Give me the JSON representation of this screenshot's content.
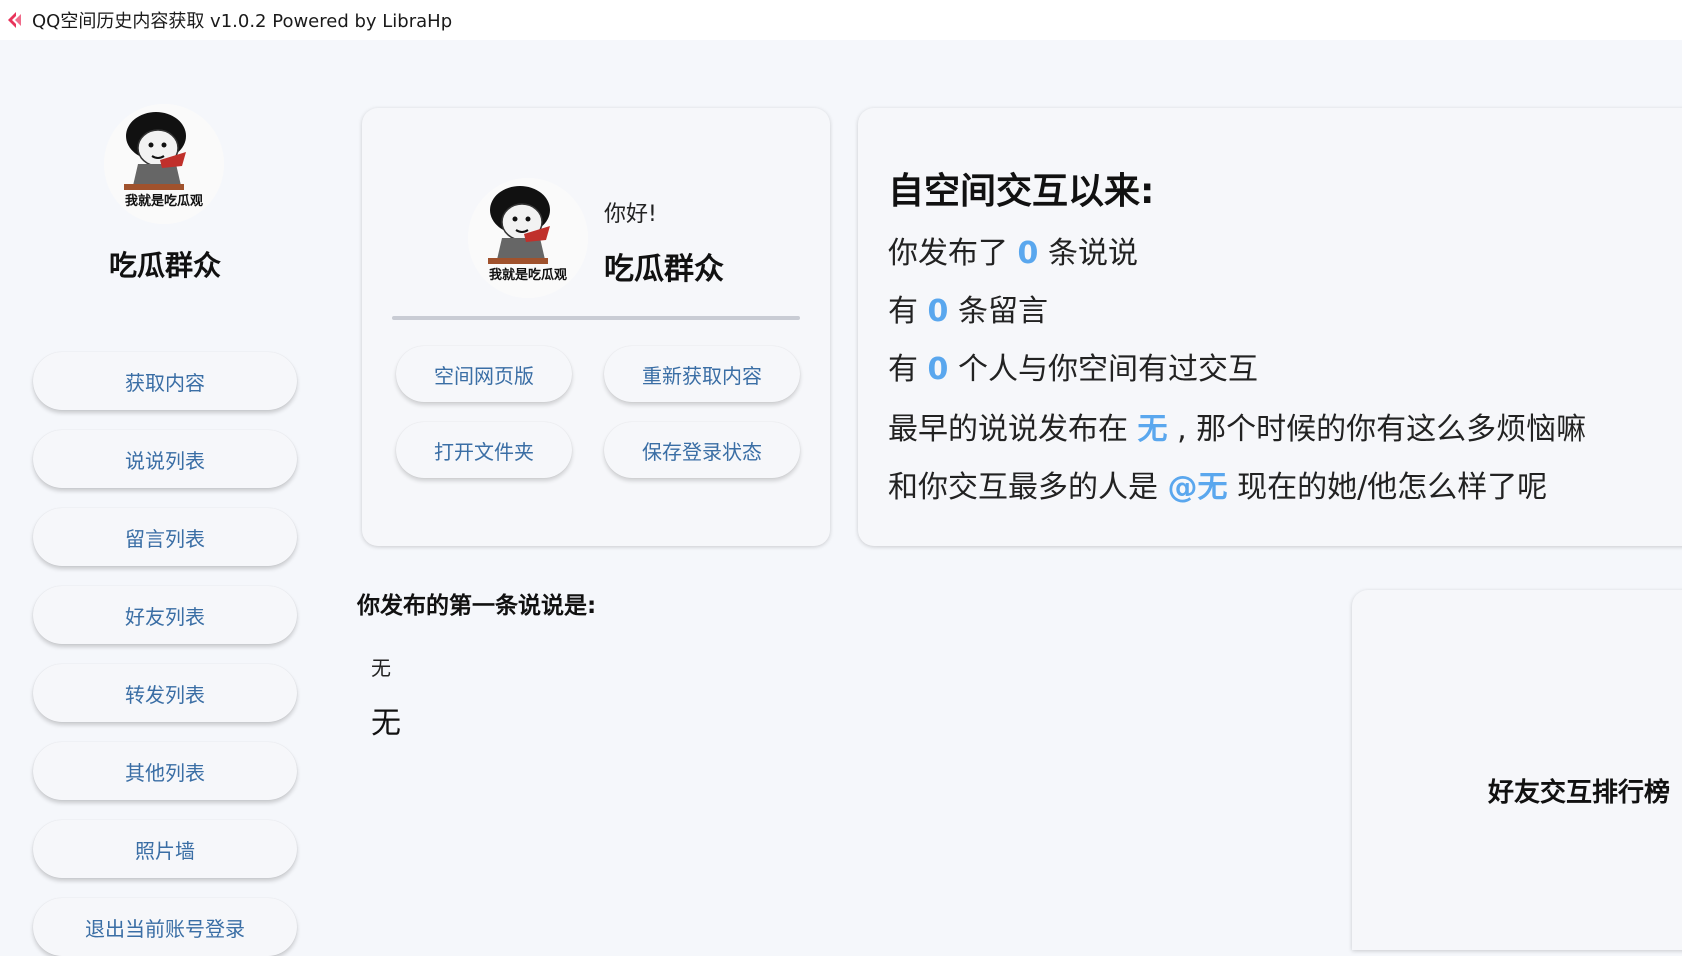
{
  "window": {
    "title": "QQ空间历史内容获取 v1.0.2 Powered by LibraHp",
    "icon": "app-logo-icon"
  },
  "sidebar": {
    "avatar_caption": "我就是吃瓜观",
    "username": "吃瓜群众",
    "items": [
      {
        "label": "获取内容"
      },
      {
        "label": "说说列表"
      },
      {
        "label": "留言列表"
      },
      {
        "label": "好友列表"
      },
      {
        "label": "转发列表"
      },
      {
        "label": "其他列表"
      },
      {
        "label": "照片墙"
      },
      {
        "label": "退出当前账号登录"
      }
    ]
  },
  "profile": {
    "greeting": "你好!",
    "username": "吃瓜群众",
    "avatar_caption": "我就是吃瓜观",
    "buttons": {
      "web": "空间网页版",
      "refetch": "重新获取内容",
      "open_folder": "打开文件夹",
      "save_login": "保存登录状态"
    }
  },
  "stats": {
    "title": "自空间交互以来:",
    "posts_prefix": "你发布了",
    "posts_count": "0",
    "posts_suffix": "条说说",
    "comments_prefix": "有",
    "comments_count": "0",
    "comments_suffix": "条留言",
    "people_prefix": "有",
    "people_count": "0",
    "people_suffix": "个人与你空间有过交互",
    "earliest_prefix": "最早的说说发布在",
    "earliest_value": "无",
    "earliest_suffix": ", 那个时候的你有这么多烦恼嘛",
    "top_prefix": "和你交互最多的人是",
    "top_value": "@无",
    "top_suffix": "现在的她/他怎么样了呢"
  },
  "first_post": {
    "title": "你发布的第一条说说是:",
    "date": "无",
    "content": "无"
  },
  "ranking": {
    "title": "好友交互排行榜"
  },
  "colors": {
    "accent": "#5aa7ee",
    "button_text": "#3a6ea5",
    "background": "#f5f7fb"
  }
}
